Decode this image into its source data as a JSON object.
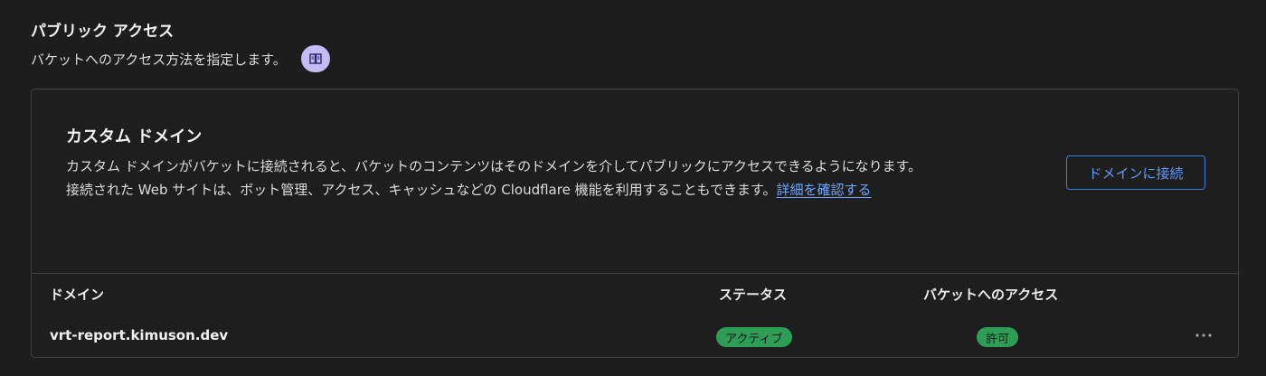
{
  "section": {
    "title": "パブリック アクセス",
    "description": "バケットへのアクセス方法を指定します。",
    "docs_icon": "book-icon"
  },
  "custom_domain": {
    "title": "カスタム ドメイン",
    "description": "カスタム ドメインがバケットに接続されると、バケットのコンテンツはそのドメインを介してパブリックにアクセスできるようになります。接続された Web サイトは、ボット管理、アクセス、キャッシュなどの Cloudflare 機能を利用することもできます。",
    "learn_more_label": "詳細を確認する",
    "connect_button_label": "ドメインに接続"
  },
  "table": {
    "headers": {
      "domain": "ドメイン",
      "status": "ステータス",
      "bucket_access": "バケットへのアクセス"
    },
    "rows": [
      {
        "domain": "vrt-report.kimuson.dev",
        "status": "アクティブ",
        "bucket_access": "許可",
        "menu_icon": "more-horizontal-icon"
      }
    ]
  },
  "colors": {
    "background": "#1d1d1d",
    "link": "#6ea7ff",
    "button_border": "#3a7fe0",
    "badge_green": "#2e9e57",
    "docs_icon_bg": "#c4bcf2"
  }
}
